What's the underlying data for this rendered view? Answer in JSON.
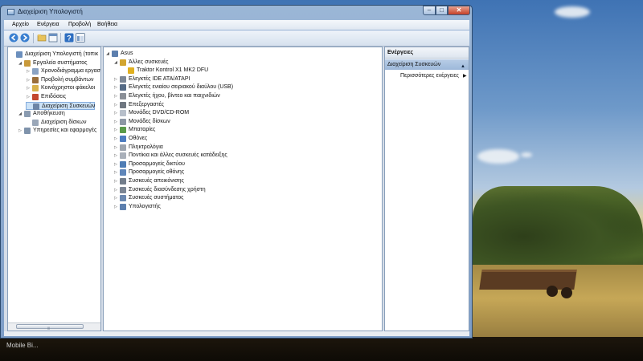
{
  "window": {
    "title": "Διαχείριση Υπολογιστή",
    "controls": {
      "minimize": "–",
      "maximize": "□",
      "close": "✕"
    }
  },
  "menu": [
    "Αρχείο",
    "Ενέργεια",
    "Προβολή",
    "Βοήθεια"
  ],
  "toolbar_icons": [
    "back-icon",
    "forward-icon",
    "up-folder-icon",
    "properties-icon",
    "help-icon",
    "console-view-icon"
  ],
  "left_tree": [
    {
      "label": "Διαχείριση Υπολογιστή (τοπικ",
      "icon": "computer-management-icon",
      "indent": 0,
      "expander": ""
    },
    {
      "label": "Εργαλεία συστήματος",
      "icon": "tools-icon",
      "indent": 1,
      "expander": "◢"
    },
    {
      "label": "Χρονοδιάγραμμα εργασ",
      "icon": "clock-icon",
      "indent": 2,
      "expander": "▷"
    },
    {
      "label": "Προβολή συμβάντων",
      "icon": "event-viewer-icon",
      "indent": 2,
      "expander": "▷"
    },
    {
      "label": "Κοινόχρηστοι φάκελοι",
      "icon": "shared-folder-icon",
      "indent": 2,
      "expander": "▷"
    },
    {
      "label": "Επιδόσεις",
      "icon": "performance-icon",
      "indent": 2,
      "expander": "▷"
    },
    {
      "label": "Διαχείριση Συσκευών",
      "icon": "device-manager-icon",
      "indent": 2,
      "expander": "",
      "selected": true
    },
    {
      "label": "Αποθήκευση",
      "icon": "storage-icon",
      "indent": 1,
      "expander": "◢"
    },
    {
      "label": "Διαχείριση δίσκων",
      "icon": "disk-icon",
      "indent": 2,
      "expander": ""
    },
    {
      "label": "Υπηρεσίες και εφαρμογές",
      "icon": "services-icon",
      "indent": 1,
      "expander": "▷"
    }
  ],
  "device_tree": [
    {
      "label": "Asus",
      "icon": "computer-icon",
      "indent": 0,
      "expander": "◢"
    },
    {
      "label": "Άλλες συσκευές",
      "icon": "unknown-device-icon",
      "indent": 1,
      "expander": "◢"
    },
    {
      "label": "Traktor Kontrol X1 MK2 DFU",
      "icon": "warning-device-icon",
      "indent": 2,
      "expander": ""
    },
    {
      "label": "Ελεγκτές IDE ATA/ATAPI",
      "icon": "ide-controller-icon",
      "indent": 1,
      "expander": "▷"
    },
    {
      "label": "Ελεγκτές ενιαίου σειριακού διαύλου (USB)",
      "icon": "usb-icon",
      "indent": 1,
      "expander": "▷"
    },
    {
      "label": "Ελεγκτές ήχου, βίντεο και παιχνιδιών",
      "icon": "sound-icon",
      "indent": 1,
      "expander": "▷"
    },
    {
      "label": "Επεξεργαστές",
      "icon": "processor-icon",
      "indent": 1,
      "expander": "▷"
    },
    {
      "label": "Μονάδες DVD/CD-ROM",
      "icon": "dvd-icon",
      "indent": 1,
      "expander": "▷"
    },
    {
      "label": "Μονάδες δίσκων",
      "icon": "disk-drive-icon",
      "indent": 1,
      "expander": "▷"
    },
    {
      "label": "Μπαταρίες",
      "icon": "battery-icon",
      "indent": 1,
      "expander": "▷"
    },
    {
      "label": "Οθόνες",
      "icon": "monitor-icon",
      "indent": 1,
      "expander": "▷"
    },
    {
      "label": "Πληκτρολόγια",
      "icon": "keyboard-icon",
      "indent": 1,
      "expander": "▷"
    },
    {
      "label": "Ποντίκια και άλλες συσκευές κατάδειξης",
      "icon": "mouse-icon",
      "indent": 1,
      "expander": "▷"
    },
    {
      "label": "Προσαρμογείς δικτύου",
      "icon": "network-adapter-icon",
      "indent": 1,
      "expander": "▷"
    },
    {
      "label": "Προσαρμογείς οθόνης",
      "icon": "display-adapter-icon",
      "indent": 1,
      "expander": "▷"
    },
    {
      "label": "Συσκευές απεικόνισης",
      "icon": "imaging-device-icon",
      "indent": 1,
      "expander": "▷"
    },
    {
      "label": "Συσκευές διασύνδεσης χρήστη",
      "icon": "hid-icon",
      "indent": 1,
      "expander": "▷"
    },
    {
      "label": "Συσκευές συστήματος",
      "icon": "system-device-icon",
      "indent": 1,
      "expander": "▷"
    },
    {
      "label": "Υπολογιστής",
      "icon": "computer-icon",
      "indent": 1,
      "expander": "▷"
    }
  ],
  "actions": {
    "header": "Ενέργειες",
    "section": "Διαχείριση Συσκευών",
    "collapse": "▲",
    "more": "Περισσότερες ενέργειες",
    "more_arrow": "▶"
  },
  "desktop": {
    "label": "Mobile Bi..."
  },
  "colors": {
    "selection": "#cde3f7",
    "selection_border": "#84acdd",
    "section_header": "#b8cde6",
    "title_bar": "#9bb6d6"
  }
}
